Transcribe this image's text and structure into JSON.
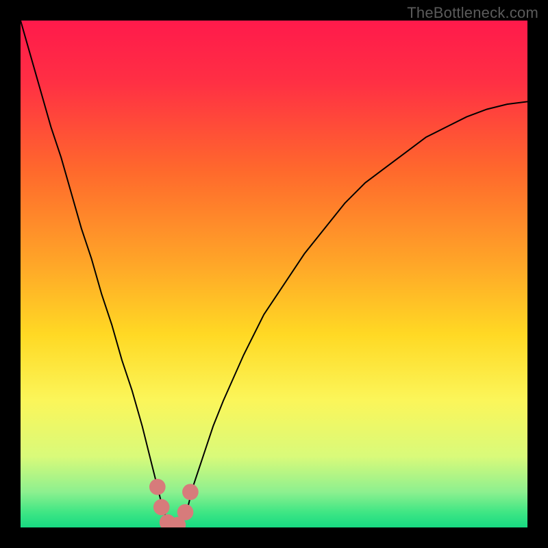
{
  "watermark": "TheBottleneck.com",
  "chart_data": {
    "type": "line",
    "title": "",
    "xlabel": "",
    "ylabel": "",
    "xlim": [
      0,
      100
    ],
    "ylim": [
      0,
      100
    ],
    "grid": false,
    "legend": false,
    "background_gradient_stops": [
      {
        "offset": 0.0,
        "color": "#ff1a4b"
      },
      {
        "offset": 0.12,
        "color": "#ff2f44"
      },
      {
        "offset": 0.3,
        "color": "#ff6a2c"
      },
      {
        "offset": 0.48,
        "color": "#ffa628"
      },
      {
        "offset": 0.62,
        "color": "#ffd924"
      },
      {
        "offset": 0.75,
        "color": "#fbf65a"
      },
      {
        "offset": 0.86,
        "color": "#d9fa7a"
      },
      {
        "offset": 0.93,
        "color": "#8df08f"
      },
      {
        "offset": 0.97,
        "color": "#3fe684"
      },
      {
        "offset": 1.0,
        "color": "#17da82"
      }
    ],
    "series": [
      {
        "name": "curve",
        "color": "#000000",
        "x": [
          0,
          2,
          4,
          6,
          8,
          10,
          12,
          14,
          16,
          18,
          20,
          22,
          24,
          26,
          27,
          28,
          29,
          30,
          31,
          32,
          33,
          34,
          36,
          38,
          40,
          44,
          48,
          52,
          56,
          60,
          64,
          68,
          72,
          76,
          80,
          84,
          88,
          92,
          96,
          100
        ],
        "y": [
          100,
          93,
          86,
          79,
          73,
          66,
          59,
          53,
          46,
          40,
          33,
          27,
          20,
          12,
          8,
          4,
          1,
          0,
          0,
          1,
          4,
          8,
          14,
          20,
          25,
          34,
          42,
          48,
          54,
          59,
          64,
          68,
          71,
          74,
          77,
          79,
          81,
          82.5,
          83.5,
          84
        ]
      }
    ],
    "markers": {
      "color": "#d77b7b",
      "points": [
        {
          "x": 27.0,
          "y": 8.0
        },
        {
          "x": 27.8,
          "y": 4.0
        },
        {
          "x": 29.0,
          "y": 1.0
        },
        {
          "x": 30.0,
          "y": 0.2
        },
        {
          "x": 31.0,
          "y": 0.5
        },
        {
          "x": 32.5,
          "y": 3.0
        },
        {
          "x": 33.5,
          "y": 7.0
        }
      ],
      "radius_pct": 1.6
    }
  }
}
